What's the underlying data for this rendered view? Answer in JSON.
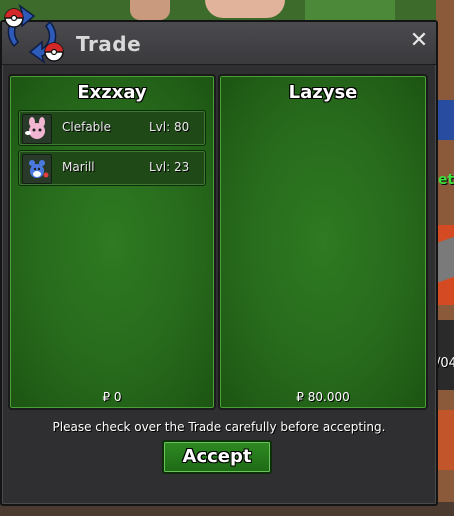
{
  "dialog": {
    "title": "Trade",
    "close_label": "✕",
    "logo_icon": "pokeball-trade-arrows-icon",
    "footer_note": "Please check over the Trade carefully before accepting.",
    "accept_label": "Accept"
  },
  "left_party": {
    "name": "Exzxay",
    "pokemon": [
      {
        "name": "Clefable",
        "level": "Lvl: 80",
        "icon": "clefable-sprite-icon"
      },
      {
        "name": "Marill",
        "level": "Lvl: 23",
        "icon": "marill-sprite-icon"
      }
    ],
    "money": "₽ 0"
  },
  "right_party": {
    "name": "Lazyse",
    "pokemon": [],
    "money": "₽ 80.000"
  },
  "background_fragments": {
    "right_green_text": "eti",
    "right_number_text": "/04"
  },
  "colors": {
    "panel_green": "#276a1c",
    "dialog_bg": "#2f2f31",
    "accept_green": "#2e8a22"
  }
}
